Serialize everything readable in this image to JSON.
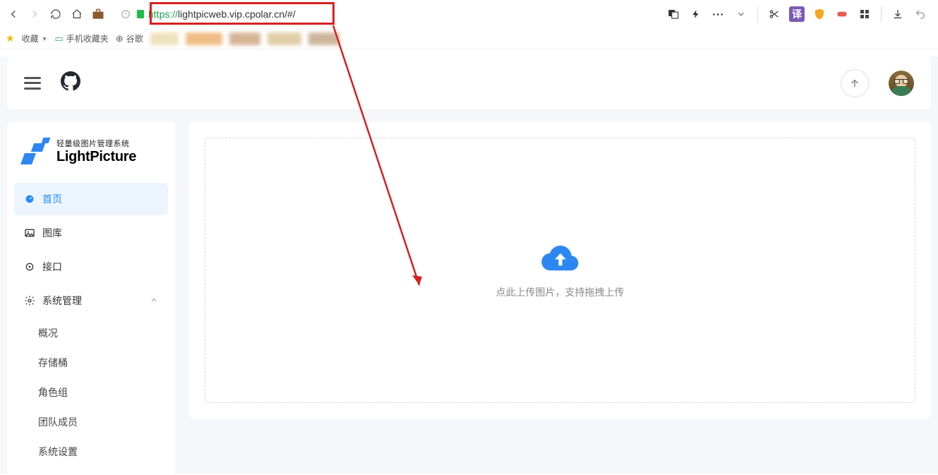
{
  "browser": {
    "url_protocol": "https://",
    "url_host": "lightpicweb.vip.cpolar.cn",
    "url_path": "/#/",
    "bookmarks_label": "收藏",
    "bm_mobile": "手机收藏夹",
    "bm_google": "谷歌",
    "translate_badge": "译"
  },
  "app": {
    "logo_sub": "轻量级图片管理系统",
    "logo_main": "LightPicture"
  },
  "sidebar": {
    "home": "首页",
    "gallery": "图库",
    "api": "接口",
    "sysmgmt": "系统管理",
    "sub": {
      "overview": "概况",
      "bucket": "存储桶",
      "roles": "角色组",
      "team": "团队成员",
      "settings": "系统设置"
    }
  },
  "upload": {
    "hint": "点此上传图片，支持拖拽上传"
  }
}
